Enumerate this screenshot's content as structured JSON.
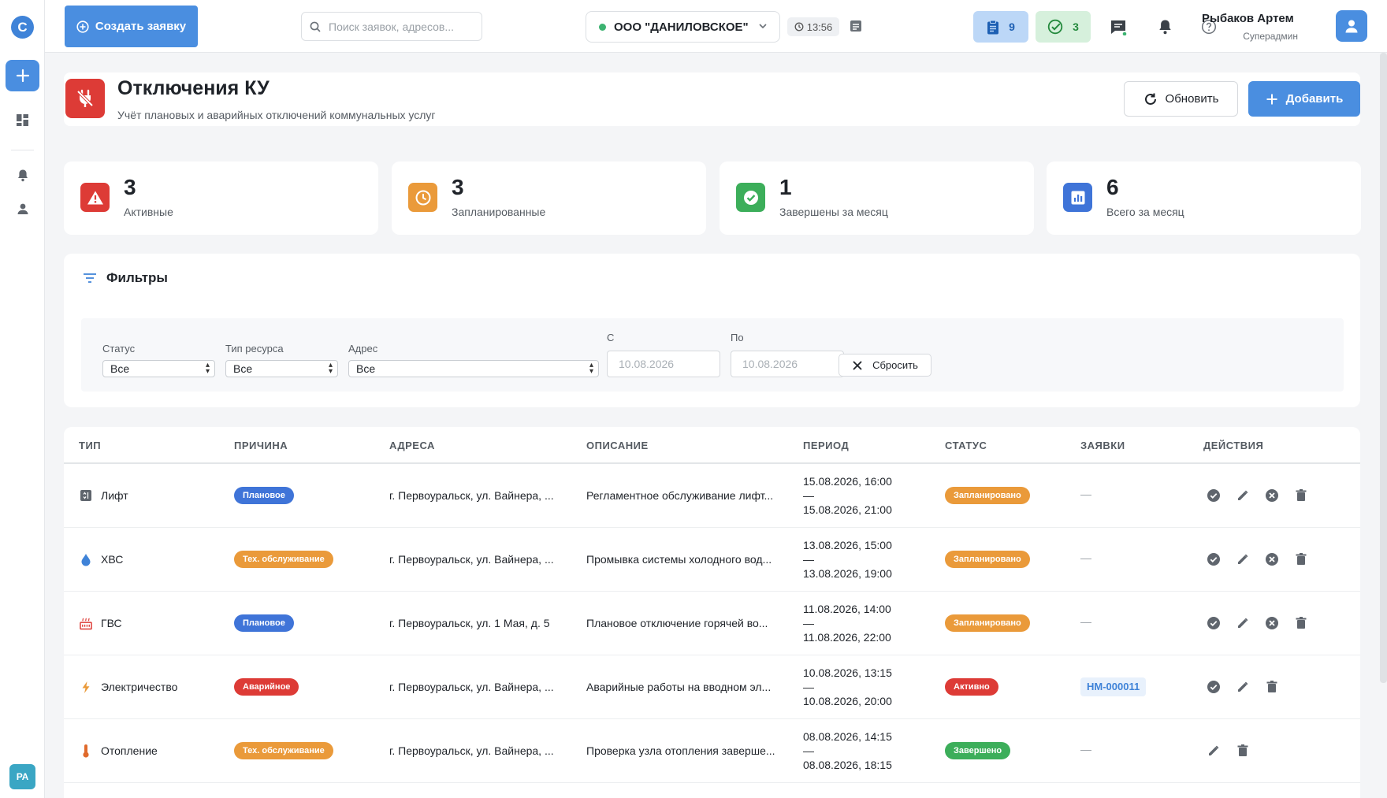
{
  "sidebar": {
    "logo_letter": "С",
    "avatar_initials": "РА"
  },
  "topbar": {
    "create_label": "Создать заявку",
    "search_placeholder": "Поиск заявок, адресов...",
    "org_name": "ООО \"ДАНИЛОВСКОЕ\"",
    "time": "13:56",
    "tasks_count": "9",
    "done_count": "3",
    "user_name": "Рыбаков Артем",
    "user_role": "Суперадмин"
  },
  "header": {
    "title": "Отключения КУ",
    "subtitle": "Учёт плановых и аварийных отключений коммунальных услуг",
    "refresh_label": "Обновить",
    "add_label": "Добавить"
  },
  "stats": [
    {
      "value": "3",
      "label": "Активные",
      "color": "#dd3b36"
    },
    {
      "value": "3",
      "label": "Запланированные",
      "color": "#ea9a3a"
    },
    {
      "value": "1",
      "label": "Завершены за месяц",
      "color": "#3cae5a"
    },
    {
      "value": "6",
      "label": "Всего за месяц",
      "color": "#3f74d8"
    }
  ],
  "filters": {
    "title": "Фильтры",
    "status_label": "Статус",
    "status_value": "Все",
    "resource_label": "Тип ресурса",
    "resource_value": "Все",
    "address_label": "Адрес",
    "address_value": "Все",
    "from_label": "С",
    "from_placeholder": "10.08.2026",
    "to_label": "По",
    "to_placeholder": "10.08.2026",
    "reset_label": "Сбросить"
  },
  "table": {
    "columns": [
      "ТИП",
      "ПРИЧИНА",
      "АДРЕСА",
      "ОПИСАНИЕ",
      "ПЕРИОД",
      "СТАТУС",
      "ЗАЯВКИ",
      "ДЕЙСТВИЯ"
    ],
    "rows": [
      {
        "type": "Лифт",
        "type_icon": "elevator-icon",
        "reason": "Плановое",
        "reason_color": "#3f74d8",
        "address": "г. Первоуральск, ул. Вайнера, ...",
        "description": "Регламентное обслуживание лифт...",
        "start": "15.08.2026, 16:00",
        "sep": "—",
        "end": "15.08.2026, 21:00",
        "status": "Запланировано",
        "status_color": "#ea9a3a",
        "request": "—"
      },
      {
        "type": "ХВС",
        "type_icon": "water-drop-icon",
        "reason": "Тех. обслуживание",
        "reason_color": "#ea9a3a",
        "address": "г. Первоуральск, ул. Вайнера, ...",
        "description": "Промывка системы холодного вод...",
        "start": "13.08.2026, 15:00",
        "sep": "—",
        "end": "13.08.2026, 19:00",
        "status": "Запланировано",
        "status_color": "#ea9a3a",
        "request": "—"
      },
      {
        "type": "ГВС",
        "type_icon": "hot-water-icon",
        "reason": "Плановое",
        "reason_color": "#3f74d8",
        "address": "г. Первоуральск, ул. 1 Мая, д. 5",
        "description": "Плановое отключение горячей во...",
        "start": "11.08.2026, 14:00",
        "sep": "—",
        "end": "11.08.2026, 22:00",
        "status": "Запланировано",
        "status_color": "#ea9a3a",
        "request": "—"
      },
      {
        "type": "Электричество",
        "type_icon": "lightning-icon",
        "reason": "Аварийное",
        "reason_color": "#dd3b36",
        "address": "г. Первоуральск, ул. Вайнера, ...",
        "description": "Аварийные работы на вводном эл...",
        "start": "10.08.2026, 13:15",
        "sep": "—",
        "end": "10.08.2026, 20:00",
        "status": "Активно",
        "status_color": "#dd3b36",
        "request": "НМ-000011"
      },
      {
        "type": "Отопление",
        "type_icon": "thermometer-icon",
        "reason": "Тех. обслуживание",
        "reason_color": "#ea9a3a",
        "address": "г. Первоуральск, ул. Вайнера, ...",
        "description": "Проверка узла отопления заверше...",
        "start": "08.08.2026, 14:15",
        "sep": "—",
        "end": "08.08.2026, 18:15",
        "status": "Завершено",
        "status_color": "#3cae5a",
        "request": "—"
      }
    ]
  }
}
